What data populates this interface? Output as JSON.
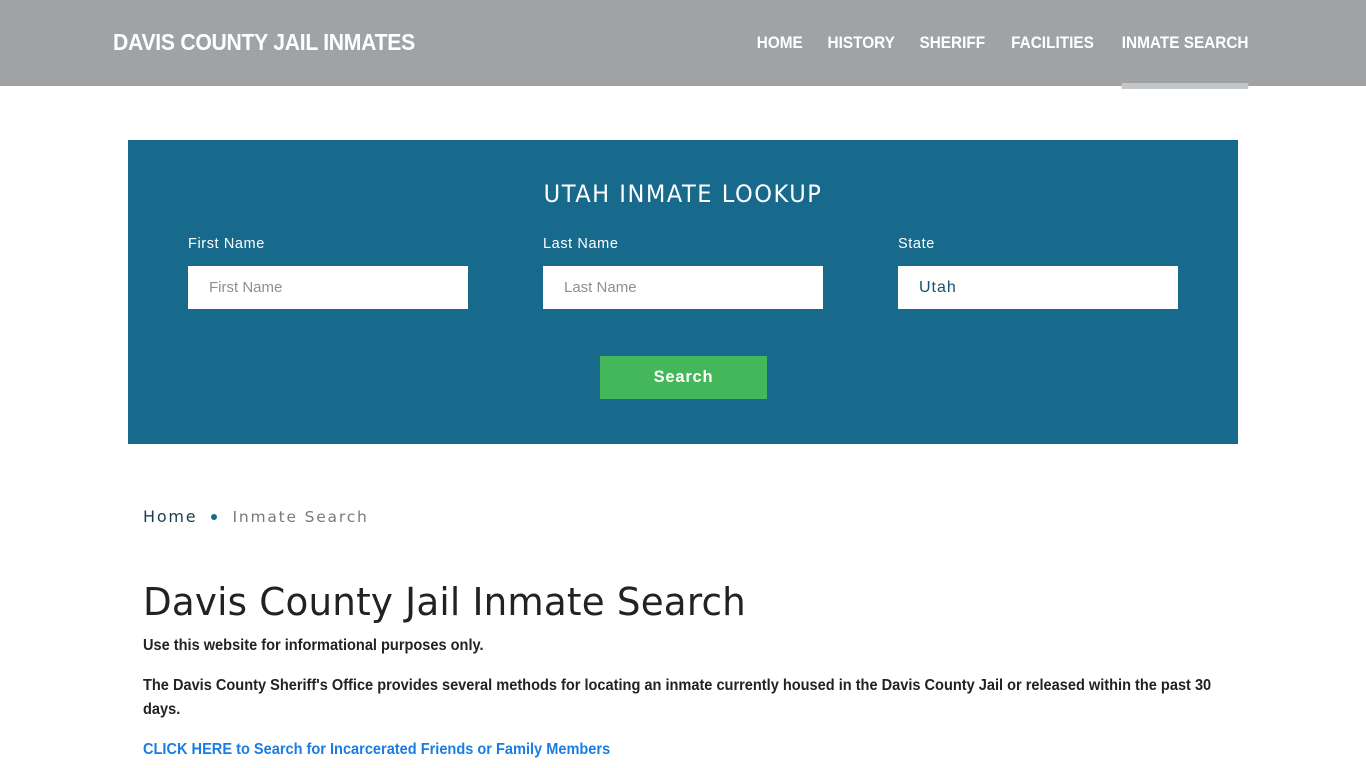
{
  "header": {
    "brand": "DAVIS COUNTY JAIL INMATES",
    "nav": [
      {
        "label": "HOME",
        "active": false
      },
      {
        "label": "HISTORY",
        "active": false
      },
      {
        "label": "SHERIFF",
        "active": false
      },
      {
        "label": "FACILITIES",
        "active": false
      },
      {
        "label": "INMATE SEARCH",
        "active": true
      }
    ]
  },
  "lookup": {
    "title": "UTAH INMATE LOOKUP",
    "first_name": {
      "label": "First Name",
      "placeholder": "First Name",
      "value": ""
    },
    "last_name": {
      "label": "Last Name",
      "placeholder": "Last Name",
      "value": ""
    },
    "state": {
      "label": "State",
      "value": "Utah"
    },
    "search_button": "Search"
  },
  "breadcrumb": {
    "home": "Home",
    "current": "Inmate Search"
  },
  "content": {
    "title": "Davis County Jail Inmate Search",
    "paragraphs": [
      "Use this website for informational purposes only.",
      "The Davis County Sheriff's Office provides several methods for locating an inmate currently housed in the Davis County Jail or released within the past 30 days."
    ],
    "cta_link": "CLICK HERE to Search for Incarcerated Friends or Family Members"
  },
  "colors": {
    "header_bg": "#9fa3a6",
    "panel_bg": "#186a8d",
    "button_bg": "#43b75a",
    "link": "#1a7de6"
  }
}
